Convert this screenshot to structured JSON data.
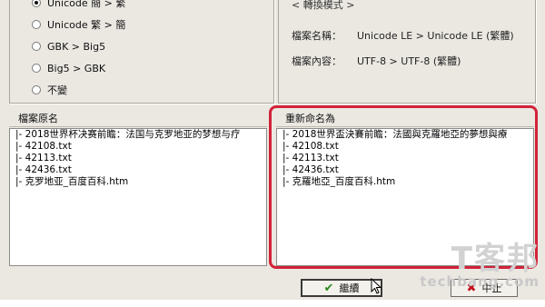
{
  "options": {
    "items": [
      {
        "label": "Unicode 簡 > 繁",
        "checked": true
      },
      {
        "label": "Unicode 繁 > 簡",
        "checked": false
      },
      {
        "label": "GBK > Big5",
        "checked": false
      },
      {
        "label": "Big5 > GBK",
        "checked": false
      },
      {
        "label": "不變",
        "checked": false
      }
    ]
  },
  "info": {
    "title": "< 轉換模式 >",
    "filename_key": "檔案名稱：",
    "filename_value": "Unicode LE > Unicode LE (繁體)",
    "content_key": "檔案內容：",
    "content_value": "UTF-8 > UTF-8 (繁體)"
  },
  "left_pane": {
    "header": "檔案原名",
    "items": [
      "|-  2018世界杯决赛前瞻：法国与克罗地亚的梦想与疗",
      "|-  42108.txt",
      "|-  42113.txt",
      "|-  42436.txt",
      "|-  克罗地亚_百度百科.htm"
    ]
  },
  "right_pane": {
    "header": "重新命名為",
    "items": [
      "|-  2018世界盃決賽前瞻：法國與克羅地亞的夢想與療",
      "|-  42108.txt",
      "|-  42113.txt",
      "|-  42436.txt",
      "|-  克羅地亞_百度百科.htm"
    ]
  },
  "buttons": {
    "continue_label": "繼續",
    "stop_label": "中止"
  },
  "watermark": {
    "big": "T客邦",
    "small": "techbang.com"
  },
  "colors": {
    "highlight": "#d3223a",
    "dialog_bg": "#ebe8e2"
  }
}
